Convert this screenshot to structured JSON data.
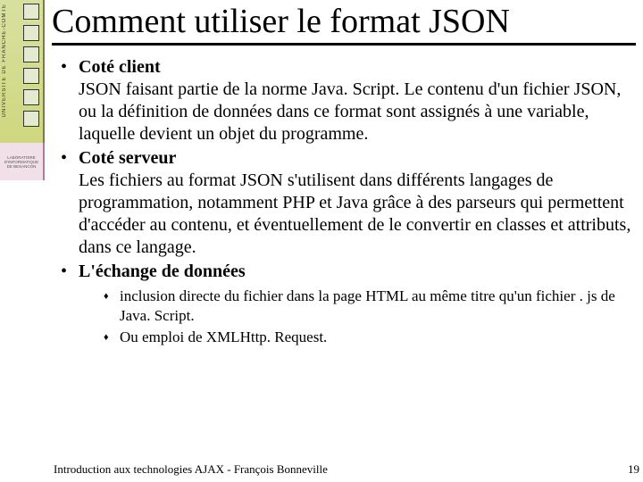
{
  "sidebar": {
    "top_label": "UNIVERSITE DE FRANCHE-COMTE",
    "mid_label": "LABORATOIRE D'INFORMATIQUE DE BESANCON"
  },
  "slide": {
    "title": "Comment utiliser le format JSON",
    "bullets": [
      {
        "head": "Coté client",
        "body": "JSON faisant partie de la norme Java. Script. Le contenu d'un fichier JSON, ou la définition de données dans ce format sont assignés à une variable, laquelle devient un objet du programme."
      },
      {
        "head": "Coté serveur",
        "body": "Les fichiers au format JSON s'utilisent dans différents langages de programmation, notamment PHP et Java grâce à des parseurs qui permettent d'accéder au contenu, et éventuellement de le convertir en classes et attributs, dans ce langage."
      },
      {
        "head": "L'échange de données",
        "body": ""
      }
    ],
    "sub": [
      "inclusion directe du fichier dans la page HTML au même titre qu'un fichier . js de Java. Script.",
      "Ou emploi de XMLHttp. Request."
    ]
  },
  "footer": {
    "text": "Introduction aux technologies AJAX - François Bonneville",
    "page": "19"
  }
}
